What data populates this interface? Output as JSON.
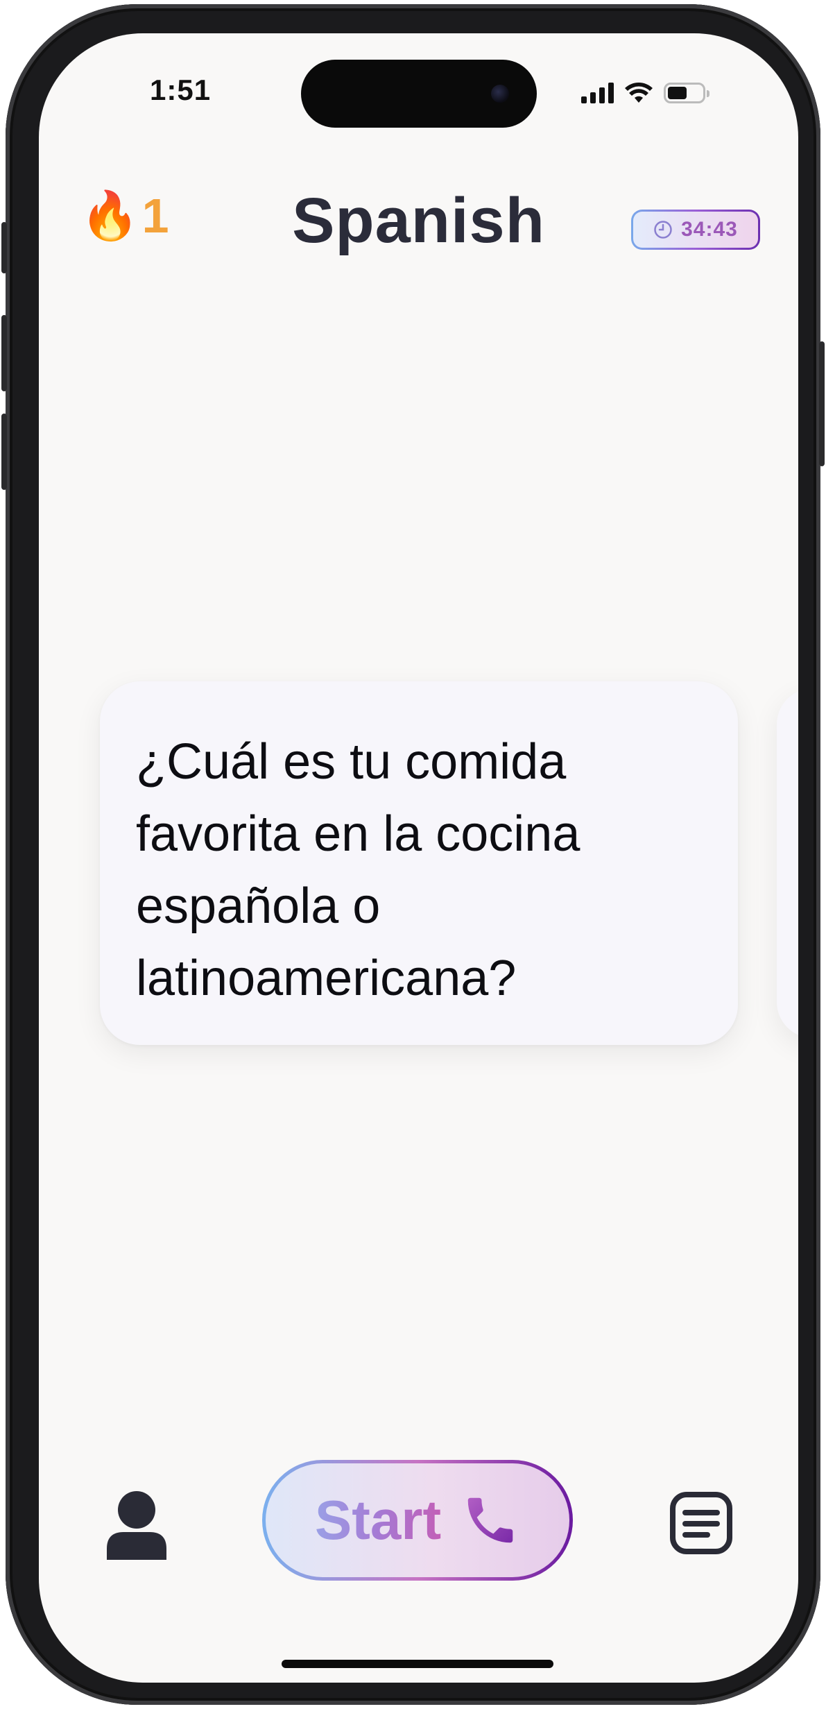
{
  "status_bar": {
    "time": "1:51",
    "icons": [
      "cellular-signal-icon",
      "wifi-icon",
      "battery-icon"
    ]
  },
  "header": {
    "streak_emoji": "🔥",
    "streak_count": "1",
    "title": "Spanish",
    "timer_icon": "clock-icon",
    "timer": "34:43"
  },
  "card": {
    "question": "¿Cuál es tu comida favorita en la cocina española o latinoamericana?"
  },
  "bottom_bar": {
    "profile_icon": "person-icon",
    "start_label": "Start",
    "start_icon": "phone-icon",
    "list_icon": "list-icon"
  },
  "colors": {
    "background": "#f9f8f7",
    "title": "#2b2c3a",
    "streak": "#f3a23b",
    "accent_purple": "#6a1aa0",
    "accent_blue": "#7ab0ee"
  }
}
